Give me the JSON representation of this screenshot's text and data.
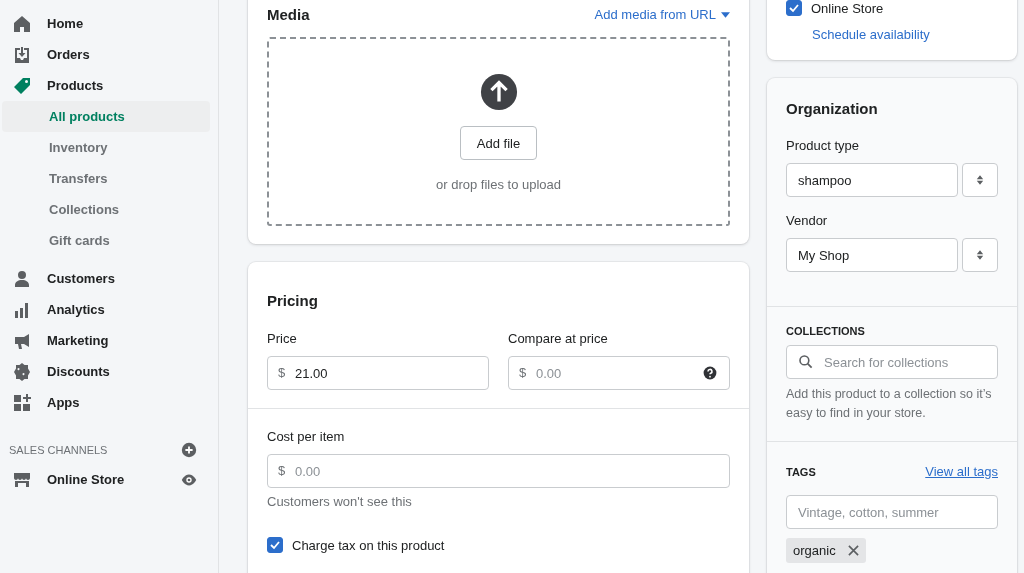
{
  "sidebar": {
    "items": [
      {
        "label": "Home",
        "selected": false
      },
      {
        "label": "Orders",
        "selected": false
      },
      {
        "label": "Products",
        "selected": true,
        "children": [
          {
            "label": "All products",
            "selected": true
          },
          {
            "label": "Inventory",
            "selected": false
          },
          {
            "label": "Transfers",
            "selected": false
          },
          {
            "label": "Collections",
            "selected": false
          },
          {
            "label": "Gift cards",
            "selected": false
          }
        ]
      },
      {
        "label": "Customers",
        "selected": false
      },
      {
        "label": "Analytics",
        "selected": false
      },
      {
        "label": "Marketing",
        "selected": false
      },
      {
        "label": "Discounts",
        "selected": false
      },
      {
        "label": "Apps",
        "selected": false
      }
    ],
    "sales_channels": {
      "heading": "SALES CHANNELS",
      "items": [
        {
          "label": "Online Store"
        }
      ]
    }
  },
  "media": {
    "title": "Media",
    "link": "Add media from URL",
    "button": "Add file",
    "hint": "or drop files to upload"
  },
  "pricing": {
    "title": "Pricing",
    "price": {
      "label": "Price",
      "prefix": "$",
      "value": "21.00"
    },
    "compare_at_price": {
      "label": "Compare at price",
      "prefix": "$",
      "placeholder": "0.00"
    },
    "cost_per_item": {
      "label": "Cost per item",
      "prefix": "$",
      "placeholder": "0.00",
      "help": "Customers won't see this"
    },
    "charge_tax": {
      "label": "Charge tax on this product",
      "checked": true
    }
  },
  "availability": {
    "channel": {
      "label": "Online Store",
      "checked": true
    },
    "link": "Schedule availability"
  },
  "organization": {
    "title": "Organization",
    "product_type": {
      "label": "Product type",
      "value": "shampoo"
    },
    "vendor": {
      "label": "Vendor",
      "value": "My Shop"
    },
    "collections": {
      "heading": "COLLECTIONS",
      "placeholder": "Search for collections",
      "help": "Add this product to a collection so it’s easy to find in your store."
    },
    "tags": {
      "heading": "TAGS",
      "link": "View all tags",
      "placeholder": "Vintage, cotton, summer",
      "items": [
        {
          "label": "organic"
        }
      ]
    }
  }
}
